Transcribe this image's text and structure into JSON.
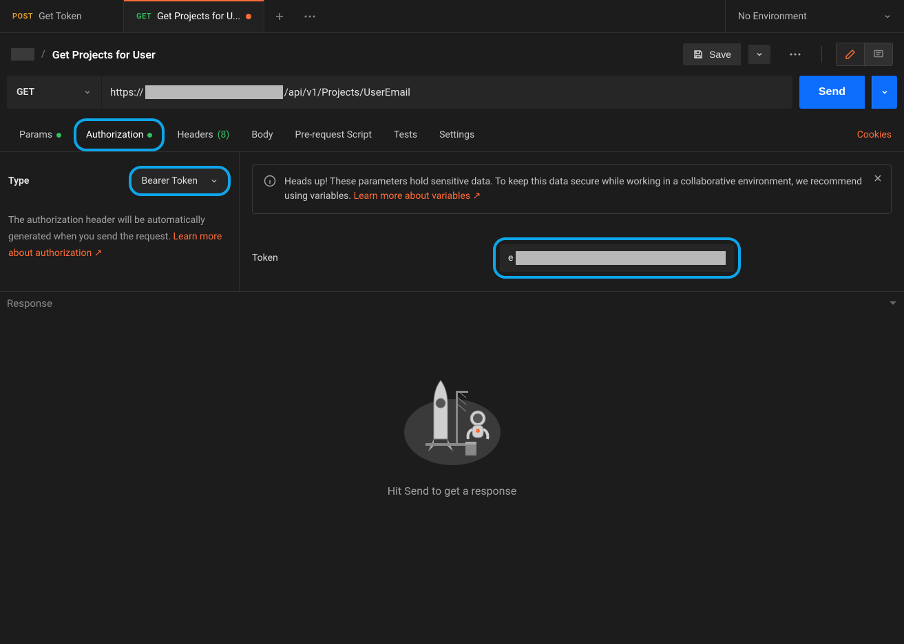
{
  "tabs": [
    {
      "method": "POST",
      "methodClass": "method-post",
      "label": "Get Token",
      "modified": false,
      "active": false
    },
    {
      "method": "GET",
      "methodClass": "method-get",
      "label": "Get Projects for U...",
      "modified": true,
      "active": true
    }
  ],
  "env": {
    "label": "No Environment"
  },
  "breadcrumb": {
    "separator": "/",
    "title": "Get Projects for User"
  },
  "toolbar": {
    "save_label": "Save"
  },
  "request": {
    "method": "GET",
    "url_prefix": "https://",
    "url_suffix": "/api/v1/Projects/UserEmail",
    "send_label": "Send"
  },
  "reqTabs": {
    "params": "Params",
    "authorization": "Authorization",
    "headers": "Headers",
    "headers_count": "(8)",
    "body": "Body",
    "prerequest": "Pre-request Script",
    "tests": "Tests",
    "settings": "Settings",
    "cookies": "Cookies"
  },
  "auth": {
    "type_label": "Type",
    "type_value": "Bearer Token",
    "desc_1": "The authorization header will be automatically generated when you send the request. ",
    "desc_link": "Learn more about authorization ↗",
    "info_text": "Heads up! These parameters hold sensitive data. To keep this data secure while working in a collaborative environment, we recommend using variables. ",
    "info_link": "Learn more about variables ↗",
    "token_label": "Token",
    "token_value_prefix": "e"
  },
  "response": {
    "header": "Response",
    "placeholder_msg": "Hit Send to get a response"
  }
}
